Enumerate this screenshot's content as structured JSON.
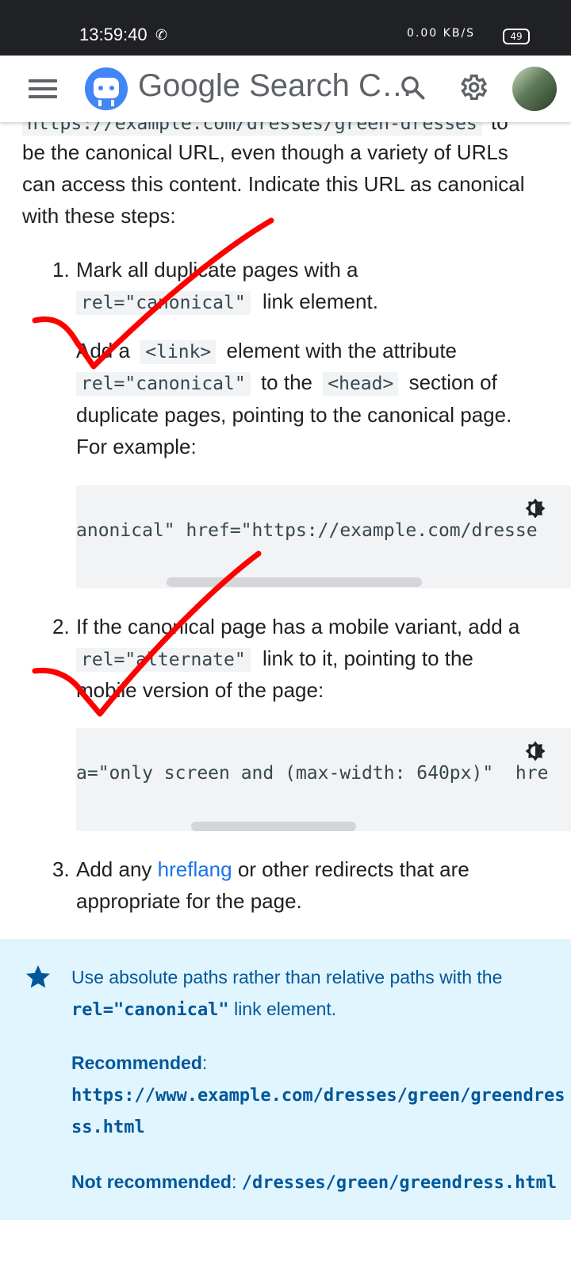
{
  "status": {
    "time": "13:59:40",
    "battery": "49",
    "net": "0.00 KB/S"
  },
  "app": {
    "title": "Google Search C…"
  },
  "intro": {
    "cut_code": "https://example.com/dresses/green-dresses",
    "cut_tail": "to",
    "line1": "be the canonical URL, even though a variety of URLs",
    "line2": "can access this content. Indicate this URL as canonical",
    "line3": "with these steps:"
  },
  "steps": [
    {
      "num": "1.",
      "line1": "Mark all duplicate pages with a",
      "code1": "rel=\"canonical\"",
      "after1": "link element.",
      "p2_pre": "Add a",
      "p2_code1": "<link>",
      "p2_mid": "element with the attribute",
      "p2_code2": "rel=\"canonical\"",
      "p2_to": "to the",
      "p2_code3": "<head>",
      "p2_after": "section of",
      "p2_line3": "duplicate pages, pointing to the canonical page.",
      "p2_line4": "For example:",
      "code_block": "anonical\" href=\"https://example.com/dresse"
    },
    {
      "num": "2.",
      "line1": "If the canonical page has a mobile variant, add a",
      "code1": "rel=\"alternate\"",
      "after1": "link to it, pointing to the",
      "line3": "mobile version of the page:",
      "code_block": "a=\"only screen and (max-width: 640px)\"  hre"
    },
    {
      "num": "3.",
      "pre": "Add any",
      "link": "hreflang",
      "post": "or other redirects that are",
      "line2": "appropriate for the page."
    }
  ],
  "note": {
    "line1": "Use absolute paths rather than relative paths with the",
    "code": "rel=\"canonical\"",
    "line2_after": "link element.",
    "recommended_label": "Recommended",
    "recommended_url_1": "https://www.example.com/dresses/green/greendres",
    "recommended_url_2": "ss.html",
    "not_recommended_label": "Not recommended",
    "not_recommended_path": "/dresses/green/greendress.html"
  },
  "colors": {
    "accent": "#1a73e8",
    "note_bg": "#e1f5fe",
    "note_text": "#01579b",
    "check": "#ff0000"
  },
  "icons": [
    "menu-icon",
    "search-console-logo-icon",
    "search-icon",
    "gear-icon",
    "theme-toggle-icon",
    "star-icon",
    "phone-icon"
  ]
}
